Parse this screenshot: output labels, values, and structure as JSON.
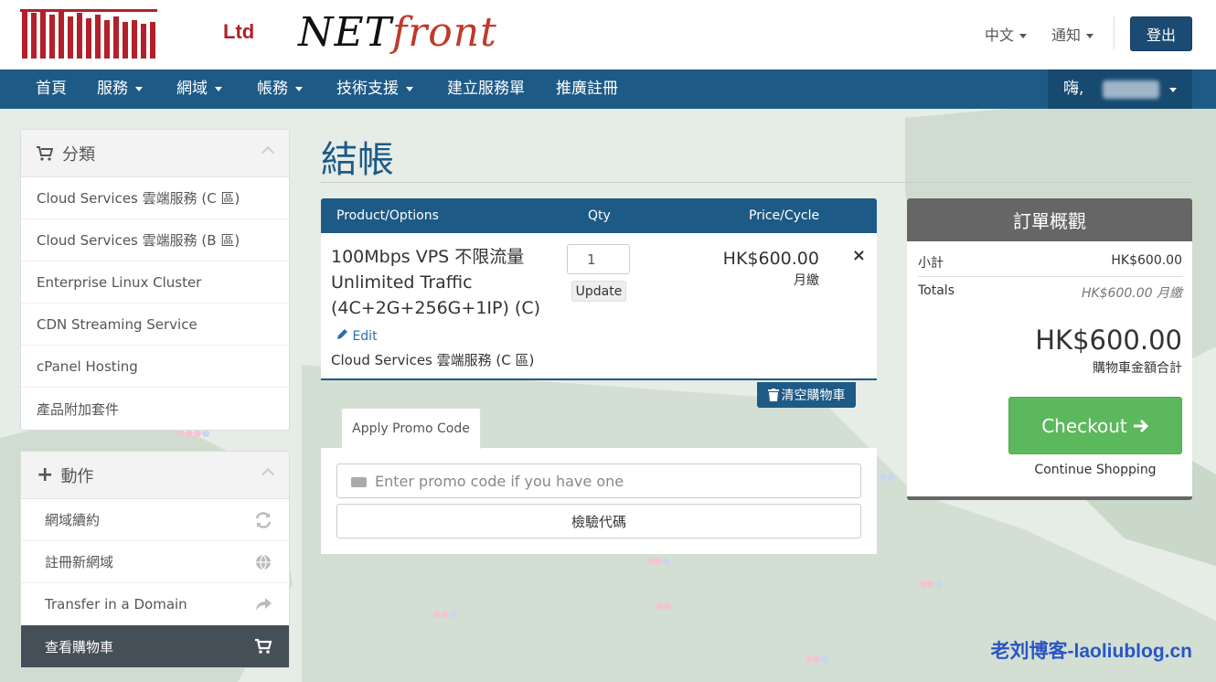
{
  "header": {
    "logo_ltd": "Ltd",
    "logo_net": "NET",
    "logo_front": "front",
    "language": "中文",
    "notifications": "通知",
    "logout": "登出"
  },
  "nav": {
    "items": [
      "首頁",
      "服務",
      "網域",
      "帳務",
      "技術支援",
      "建立服務單",
      "推廣註冊"
    ],
    "greeting": "嗨,"
  },
  "sidebar": {
    "categories_title": "分類",
    "categories": [
      "Cloud Services 雲端服務 (C 區)",
      "Cloud Services 雲端服務 (B 區)",
      "Enterprise Linux Cluster",
      "CDN Streaming Service",
      "cPanel Hosting",
      "產品附加套件"
    ],
    "actions_title": "動作",
    "actions": [
      "網域續約",
      "註冊新網域",
      "Transfer in a Domain",
      "查看購物車"
    ]
  },
  "page": {
    "title": "結帳"
  },
  "cart": {
    "col_product": "Product/Options",
    "col_qty": "Qty",
    "col_price": "Price/Cycle",
    "product_line1": "100Mbps VPS 不限流量",
    "product_line2": "Unlimited Traffic",
    "product_line3": "(4C+2G+256G+1IP) (C)",
    "edit": "Edit",
    "group": "Cloud Services 雲端服務 (C 區)",
    "qty": "1",
    "update": "Update",
    "price": "HK$600.00",
    "cycle": "月繳",
    "remove": "×",
    "empty_cart": "清空購物車"
  },
  "promo": {
    "tab": "Apply Promo Code",
    "placeholder": "Enter promo code if you have one",
    "validate": "檢驗代碼"
  },
  "summary": {
    "title": "訂單概觀",
    "subtotal_label": "小計",
    "subtotal": "HK$600.00",
    "totals_label": "Totals",
    "totals": "HK$600.00 月繳",
    "total": "HK$600.00",
    "total_label": "購物車金額合計",
    "checkout": "Checkout",
    "continue": "Continue Shopping"
  },
  "watermark": "老刘博客-laoliublog.cn",
  "colors": {
    "primary": "#1e5a86",
    "success": "#5cb85c",
    "summary_head": "#666666"
  }
}
